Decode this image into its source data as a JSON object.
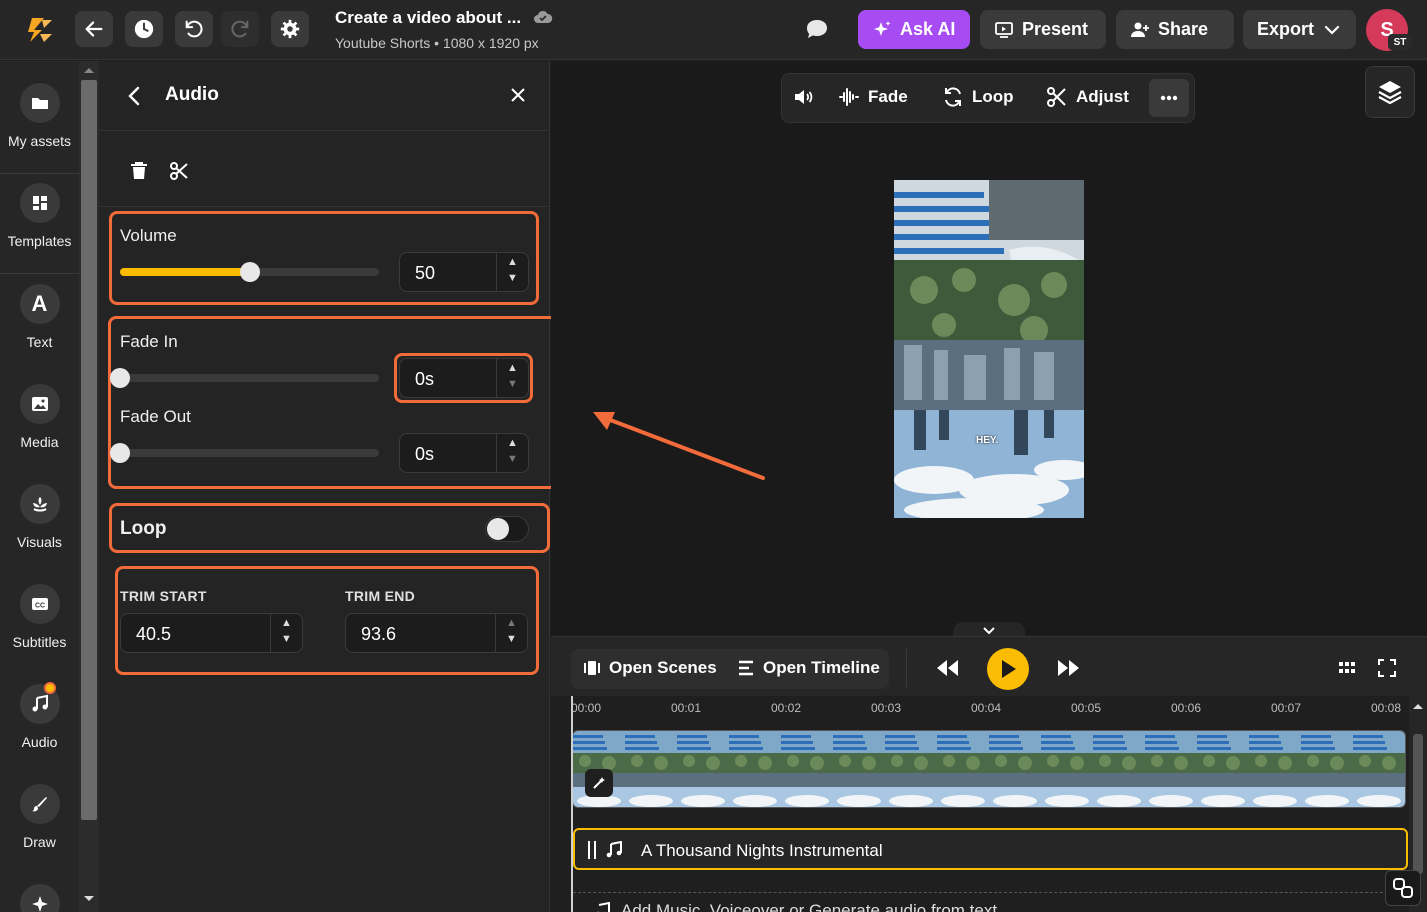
{
  "topbar": {
    "doc_title": "Create a video about ...",
    "doc_subtitle": "Youtube Shorts • 1080 x 1920 px",
    "ask_ai": "Ask AI",
    "present": "Present",
    "share": "Share",
    "export": "Export",
    "avatar_initial": "S",
    "avatar_badge": "ST",
    "colors": {
      "accent_ai": "#a64cf2",
      "avatar": "#d63a5a",
      "logo": "#f5a623"
    }
  },
  "leftnav": {
    "items": [
      {
        "label": "My assets",
        "icon": "folder-icon"
      },
      {
        "label": "Templates",
        "icon": "templates-icon"
      },
      {
        "label": "Text",
        "icon": "text-icon"
      },
      {
        "label": "Media",
        "icon": "image-icon"
      },
      {
        "label": "Visuals",
        "icon": "visuals-icon"
      },
      {
        "label": "Subtitles",
        "icon": "cc-icon"
      },
      {
        "label": "Audio",
        "icon": "music-note-icon"
      },
      {
        "label": "Draw",
        "icon": "brush-icon"
      }
    ]
  },
  "panel": {
    "title": "Audio",
    "volume_label": "Volume",
    "volume_value": "50",
    "volume_level": 0.5,
    "fade_in_label": "Fade In",
    "fade_in_value": "0s",
    "fade_out_label": "Fade Out",
    "fade_out_value": "0s",
    "loop_label": "Loop",
    "loop_on": false,
    "trim_start_label": "TRIM START",
    "trim_start_value": "40.5",
    "trim_end_label": "TRIM END",
    "trim_end_value": "93.6",
    "colors": {
      "highlight": "#f26b3a",
      "slider_fill": "#fbbc04"
    }
  },
  "canvas_toolbar": {
    "fade": "Fade",
    "loop": "Loop",
    "adjust": "Adjust"
  },
  "preview": {
    "caption": "HEY."
  },
  "controls": {
    "open_scenes": "Open Scenes",
    "open_timeline": "Open Timeline"
  },
  "timeline": {
    "ticks": [
      "00:00",
      "00:01",
      "00:02",
      "00:03",
      "00:04",
      "00:05",
      "00:06",
      "00:07",
      "00:08"
    ],
    "audio_track_name": "A Thousand Nights Instrumental",
    "add_prompt": "Add Music, Voiceover or Generate audio from text"
  }
}
